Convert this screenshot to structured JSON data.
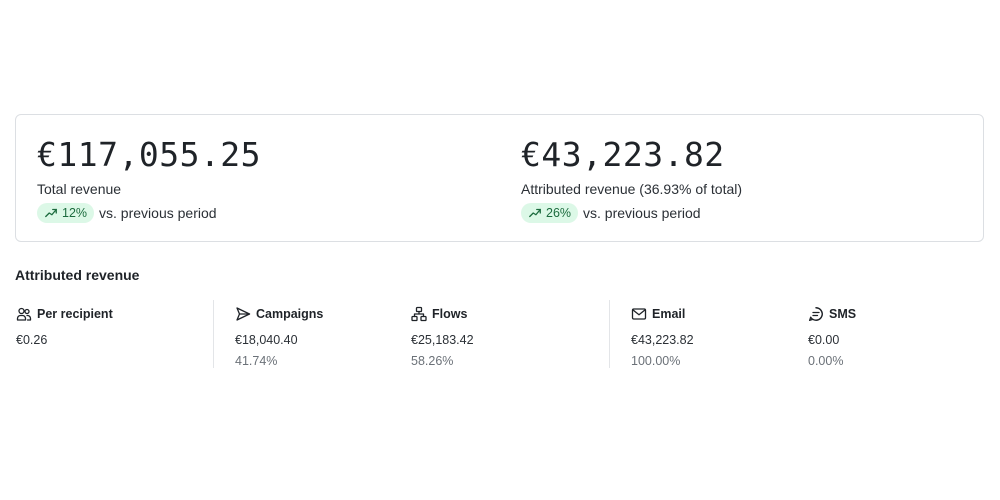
{
  "summary": {
    "total": {
      "value": "€117,055.25",
      "label": "Total revenue",
      "trend": "12%",
      "comparison": "vs. previous period"
    },
    "attributed": {
      "value": "€43,223.82",
      "label": "Attributed revenue (36.93% of total)",
      "trend": "26%",
      "comparison": "vs. previous period"
    }
  },
  "attributed_section": {
    "title": "Attributed revenue",
    "per_recipient": {
      "title": "Per recipient",
      "value": "€0.26",
      "icon": "users-icon"
    },
    "campaigns": {
      "title": "Campaigns",
      "value": "€18,040.40",
      "pct": "41.74%",
      "icon": "send-icon"
    },
    "flows": {
      "title": "Flows",
      "value": "€25,183.42",
      "pct": "58.26%",
      "icon": "flows-icon"
    },
    "email": {
      "title": "Email",
      "value": "€43,223.82",
      "pct": "100.00%",
      "icon": "mail-icon"
    },
    "sms": {
      "title": "SMS",
      "value": "€0.00",
      "pct": "0.00%",
      "icon": "message-icon"
    }
  },
  "colors": {
    "trend_bg": "#dcf8e7",
    "trend_fg": "#1c6b3e",
    "border": "#dcdfe3"
  }
}
